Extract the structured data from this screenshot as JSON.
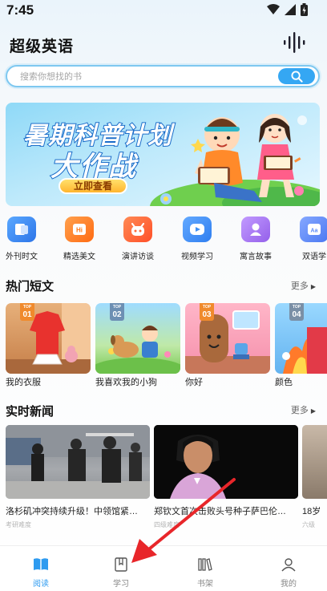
{
  "status_bar": {
    "time": "7:45"
  },
  "header": {
    "title": "超级英语",
    "voice_icon": "voice-wave-icon"
  },
  "search": {
    "placeholder": "搜索你想找的书",
    "button_icon": "search-icon"
  },
  "banner": {
    "line1": "暑期科普计划",
    "line2": "大作战",
    "cta": "立即查看"
  },
  "categories": [
    {
      "label": "外刊时文",
      "icon": "magazine-icon",
      "color": "#3d8ef0"
    },
    {
      "label": "精选美文",
      "icon": "hifi-icon",
      "color": "#ff7a1a"
    },
    {
      "label": "演讲访谈",
      "icon": "mascot-icon",
      "color": "#ff6a3a"
    },
    {
      "label": "视频学习",
      "icon": "video-icon",
      "color": "#3e8ff5"
    },
    {
      "label": "寓言故事",
      "icon": "character-icon",
      "color": "#a872ee"
    },
    {
      "label": "双语学",
      "icon": "bilingual-icon",
      "color": "#5b8af7"
    }
  ],
  "hot_stories": {
    "title": "热门短文",
    "more": "更多",
    "items": [
      {
        "rank_label": "TOP",
        "rank": "01",
        "title": "我的衣服",
        "badge_color": "#f08a2c"
      },
      {
        "rank_label": "TOP",
        "rank": "02",
        "title": "我喜欢我的小狗",
        "badge_color": "#6d8fb3"
      },
      {
        "rank_label": "TOP",
        "rank": "03",
        "title": "你好",
        "badge_color": "#f08a2c"
      },
      {
        "rank_label": "TOP",
        "rank": "04",
        "title": "颜色",
        "badge_color": "#7a8fa6"
      }
    ]
  },
  "news": {
    "title": "实时新闻",
    "more": "更多",
    "items": [
      {
        "title": "洛杉矶冲突持续升级！中领馆紧…",
        "source": "考研难度"
      },
      {
        "title": "郑钦文首次击败头号种子萨巴伦…",
        "source": "四级难度"
      },
      {
        "title": "18岁",
        "source": "六级"
      }
    ]
  },
  "bottom_nav": [
    {
      "label": "阅读",
      "icon": "book-open-icon",
      "active": true
    },
    {
      "label": "学习",
      "icon": "bookmark-icon",
      "active": false
    },
    {
      "label": "书架",
      "icon": "bookshelf-icon",
      "active": false
    },
    {
      "label": "我的",
      "icon": "profile-icon",
      "active": false
    }
  ],
  "colors": {
    "accent": "#2e9bf0",
    "search_border": "#7ec8f0",
    "annotation_arrow": "#e8262a"
  }
}
